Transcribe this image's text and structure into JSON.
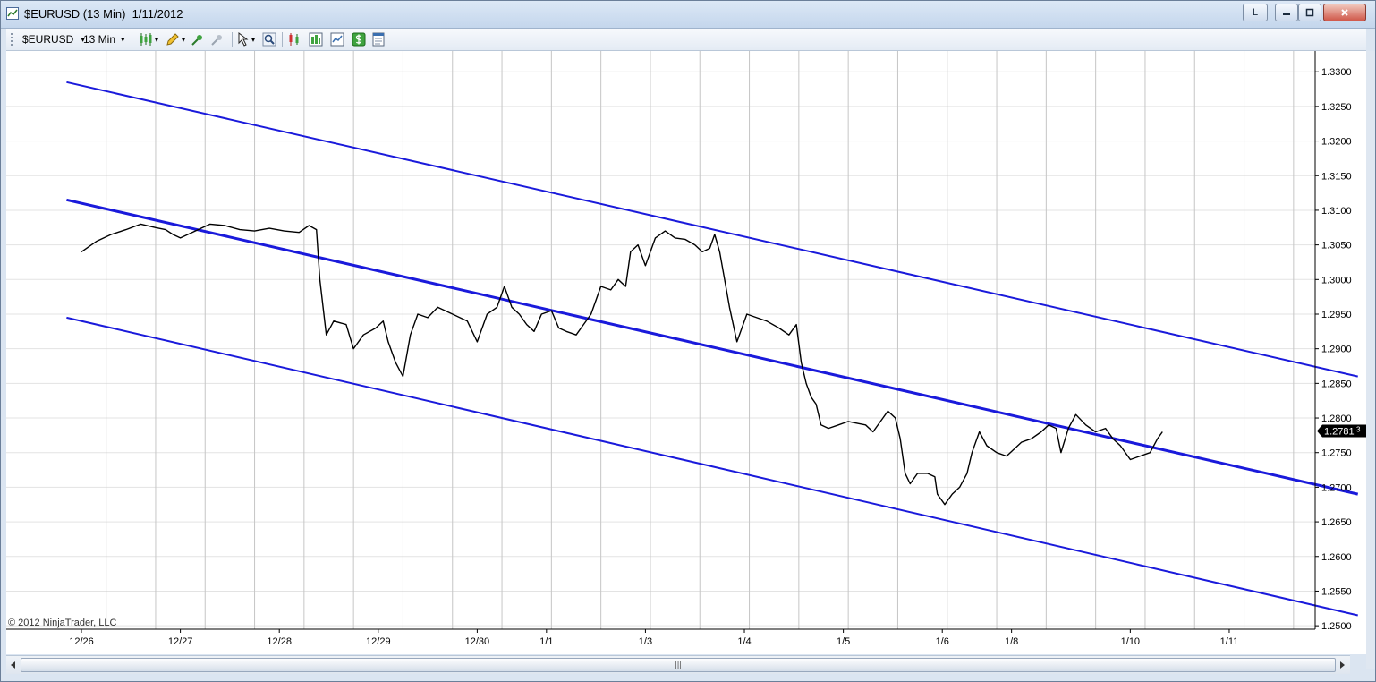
{
  "window": {
    "title": "$EURUSD (13 Min)  1/11/2012",
    "buttons": {
      "link": "L",
      "minimize": "—",
      "maximize": "▢",
      "close": "✕"
    }
  },
  "toolbar": {
    "instrument": "$EURUSD",
    "interval": "13 Min",
    "dropdown_arrow": "▾"
  },
  "chart": {
    "copyright": "© 2012 NinjaTrader, LLC",
    "price_marker": "1.2781",
    "price_marker_sup": "3",
    "channel_color": "#1a1adb",
    "price_line_color": "#000000",
    "scroll_thumb_grip": "|||"
  },
  "chart_data": {
    "type": "line",
    "instrument": "$EURUSD",
    "x_labels": [
      "12/26",
      "12/27",
      "12/28",
      "12/29",
      "12/30",
      "1/1",
      "1/3",
      "1/4",
      "1/5",
      "1/6",
      "1/8",
      "1/10",
      "1/11"
    ],
    "y_ticks": [
      "1.3300",
      "1.3250",
      "1.3200",
      "1.3150",
      "1.3100",
      "1.3050",
      "1.3000",
      "1.2950",
      "1.2900",
      "1.2850",
      "1.2800",
      "1.2750",
      "1.2700",
      "1.2650",
      "1.2600",
      "1.2550",
      "1.2500"
    ],
    "ylim": [
      1.2495,
      1.333
    ],
    "grid": true,
    "last_price": 1.27813,
    "price_series": [
      [
        0.0,
        1.304
      ],
      [
        0.3,
        1.3055
      ],
      [
        0.6,
        1.3065
      ],
      [
        0.9,
        1.3072
      ],
      [
        1.2,
        1.308
      ],
      [
        1.5,
        1.3075
      ],
      [
        1.7,
        1.3072
      ],
      [
        1.85,
        1.3065
      ],
      [
        2.0,
        1.306
      ],
      [
        2.3,
        1.307
      ],
      [
        2.6,
        1.308
      ],
      [
        2.9,
        1.3078
      ],
      [
        3.2,
        1.3072
      ],
      [
        3.5,
        1.307
      ],
      [
        3.8,
        1.3074
      ],
      [
        4.1,
        1.307
      ],
      [
        4.4,
        1.3068
      ],
      [
        4.6,
        1.3078
      ],
      [
        4.75,
        1.3072
      ],
      [
        4.82,
        1.3
      ],
      [
        4.9,
        1.295
      ],
      [
        4.95,
        1.292
      ],
      [
        5.1,
        1.294
      ],
      [
        5.35,
        1.2935
      ],
      [
        5.5,
        1.29
      ],
      [
        5.7,
        1.292
      ],
      [
        5.95,
        1.293
      ],
      [
        6.1,
        1.294
      ],
      [
        6.2,
        1.291
      ],
      [
        6.35,
        1.288
      ],
      [
        6.5,
        1.286
      ],
      [
        6.65,
        1.292
      ],
      [
        6.8,
        1.295
      ],
      [
        7.0,
        1.2945
      ],
      [
        7.2,
        1.296
      ],
      [
        7.5,
        1.295
      ],
      [
        7.8,
        1.294
      ],
      [
        8.0,
        1.291
      ],
      [
        8.2,
        1.295
      ],
      [
        8.4,
        1.296
      ],
      [
        8.55,
        1.299
      ],
      [
        8.7,
        1.296
      ],
      [
        8.85,
        1.295
      ],
      [
        9.0,
        1.2935
      ],
      [
        9.15,
        1.2925
      ],
      [
        9.3,
        1.295
      ],
      [
        9.5,
        1.2955
      ],
      [
        9.65,
        1.293
      ],
      [
        9.8,
        1.2925
      ],
      [
        10.0,
        1.292
      ],
      [
        10.1,
        1.293
      ],
      [
        10.3,
        1.295
      ],
      [
        10.5,
        1.299
      ],
      [
        10.7,
        1.2985
      ],
      [
        10.85,
        1.3
      ],
      [
        11.0,
        1.299
      ],
      [
        11.1,
        1.304
      ],
      [
        11.25,
        1.305
      ],
      [
        11.4,
        1.302
      ],
      [
        11.6,
        1.306
      ],
      [
        11.8,
        1.307
      ],
      [
        12.0,
        1.306
      ],
      [
        12.2,
        1.3058
      ],
      [
        12.4,
        1.305
      ],
      [
        12.55,
        1.304
      ],
      [
        12.7,
        1.3045
      ],
      [
        12.8,
        1.3065
      ],
      [
        12.9,
        1.304
      ],
      [
        13.0,
        1.3
      ],
      [
        13.1,
        1.296
      ],
      [
        13.25,
        1.291
      ],
      [
        13.45,
        1.295
      ],
      [
        13.65,
        1.2945
      ],
      [
        13.85,
        1.294
      ],
      [
        14.1,
        1.293
      ],
      [
        14.3,
        1.292
      ],
      [
        14.45,
        1.2935
      ],
      [
        14.55,
        1.288
      ],
      [
        14.65,
        1.285
      ],
      [
        14.75,
        1.283
      ],
      [
        14.85,
        1.282
      ],
      [
        14.95,
        1.279
      ],
      [
        15.1,
        1.2785
      ],
      [
        15.3,
        1.279
      ],
      [
        15.5,
        1.2795
      ],
      [
        15.7,
        1.2792
      ],
      [
        15.85,
        1.279
      ],
      [
        16.0,
        1.278
      ],
      [
        16.2,
        1.28
      ],
      [
        16.3,
        1.281
      ],
      [
        16.45,
        1.28
      ],
      [
        16.55,
        1.277
      ],
      [
        16.65,
        1.272
      ],
      [
        16.75,
        1.2705
      ],
      [
        16.9,
        1.272
      ],
      [
        17.1,
        1.272
      ],
      [
        17.25,
        1.2715
      ],
      [
        17.3,
        1.269
      ],
      [
        17.45,
        1.2675
      ],
      [
        17.6,
        1.269
      ],
      [
        17.75,
        1.27
      ],
      [
        17.9,
        1.272
      ],
      [
        18.0,
        1.275
      ],
      [
        18.15,
        1.278
      ],
      [
        18.3,
        1.276
      ],
      [
        18.5,
        1.275
      ],
      [
        18.7,
        1.2745
      ],
      [
        18.85,
        1.2755
      ],
      [
        19.0,
        1.2765
      ],
      [
        19.2,
        1.277
      ],
      [
        19.4,
        1.278
      ],
      [
        19.55,
        1.279
      ],
      [
        19.7,
        1.2785
      ],
      [
        19.8,
        1.275
      ],
      [
        19.95,
        1.2785
      ],
      [
        20.1,
        1.2805
      ],
      [
        20.3,
        1.279
      ],
      [
        20.5,
        1.278
      ],
      [
        20.7,
        1.2785
      ],
      [
        20.85,
        1.277
      ],
      [
        21.0,
        1.276
      ],
      [
        21.2,
        1.274
      ],
      [
        21.4,
        1.2745
      ],
      [
        21.6,
        1.275
      ],
      [
        21.75,
        1.277
      ],
      [
        21.85,
        1.278
      ]
    ],
    "channel_lines": [
      {
        "name": "upper",
        "from": [
          -0.3,
          1.3285
        ],
        "to": [
          25.8,
          1.286
        ]
      },
      {
        "name": "middle",
        "from": [
          -0.3,
          1.3115
        ],
        "to": [
          25.8,
          1.269
        ]
      },
      {
        "name": "lower",
        "from": [
          -0.3,
          1.2945
        ],
        "to": [
          25.8,
          1.2515
        ]
      }
    ]
  }
}
